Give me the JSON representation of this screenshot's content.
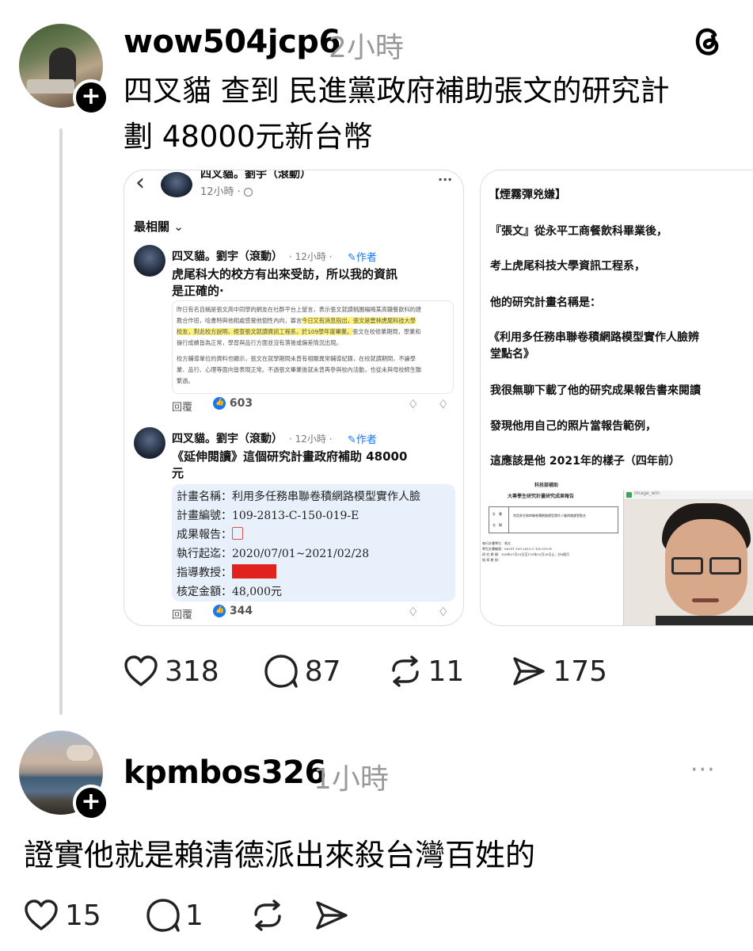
{
  "post": {
    "username": "wow504jcp6",
    "time": "2小時",
    "text_line1": "四叉貓 查到 民進黨政府補助張文的研究計",
    "text_line2": "劃 48000元新台幣",
    "plus": "+",
    "actions": {
      "likes": "318",
      "comments": "87",
      "reposts": "11",
      "shares": "175"
    }
  },
  "card1": {
    "back": "‹",
    "header_name": "四叉貓。劉宇（滾動）",
    "header_time": "12小時 · ",
    "more": "···",
    "sort_label": "最相關",
    "sort_chevron": "⌄",
    "c1_name": "四叉貓。劉宇（滾動）",
    "c1_time": "· 12小時 ·",
    "c1_author": "作者",
    "c1_text1": "虎尾科大的校方有出來受訪，所以我的資訊",
    "c1_text2": "是正確的·",
    "quote_l1": "昨日有名自稱是張文高中同學的網友在社群平台上留言，表示張文就讀桃園楊梅某高職餐飲科的建",
    "quote_l2": "教合作班，唸書時與他相處感覺他個性內向，寡言",
    "quote_l2b": "今日又有消息指出，張文是雲林虎尾科技大學",
    "quote_l3a": "校友，對此校方說明，經查張文就讀資訊工程系，於109學年度畢業。",
    "quote_l3b": "張文在校修業期間，學業和",
    "quote_l4": "操行成績皆為正常，學習與品行方面並沒有落後或偏差情況出現。",
    "quote_l5": "校方輔導單位的資料也顯示，張文在就學期間未曾有相關異常輔導紀錄，在校就讀期間，不論學",
    "quote_l6": "業、品行、心理等面向皆表現正常。不過張文畢業後就未曾再參與校內活動，也從未與母校師生聯",
    "quote_l7": "繫過。",
    "c1_reply": "回覆",
    "c1_likes": "603",
    "c2_name": "四叉貓。劉宇（滾動）",
    "c2_time": "· 12小時 ·",
    "c2_author": "作者",
    "c2_text1": "《延伸閱讀》這個研究計畫政府補助 48000",
    "c2_text2": "元",
    "plan": {
      "name_label": "計畫名稱：",
      "name_value": "利用多任務串聯卷積網路模型實作人臉",
      "id_label": "計畫編號：",
      "id_value": "109-2813-C-150-019-E",
      "report_label": "成果報告：",
      "period_label": "執行起迄：",
      "period_value": "2020/07/01~2021/02/28",
      "advisor_label": "指導教授：",
      "amount_label": "核定金額：",
      "amount_value": "48,000元"
    },
    "c2_reply": "回覆",
    "c2_likes": "344"
  },
  "card2": {
    "title": "【煙霧彈兇嫌】",
    "p1": "『張文』從永平工商餐飲科畢業後，",
    "p2": "考上虎尾科技大學資訊工程系，",
    "p3": "他的研究計畫名稱是：",
    "p4a": "《利用多任務串聯卷積網路模型實作人臉辨",
    "p4b": "堂點名》",
    "p5": "我很無聊下載了他的研究成果報告書來閱讀",
    "p6": "發現他用自己的照片當報告範例，",
    "p7": "這應該是他 2021年的樣子（四年前）",
    "doc_h1": "科技部補助",
    "doc_h2": "大專學生研究計畫研究成果報告",
    "doc_c1": "計　畫",
    "doc_c2": "名　稱",
    "doc_c3": "利用多任務串聯卷積網路模型實作人臉辨識課堂點名",
    "doc_r1": "執行計畫學生：張文",
    "doc_r2": "學生計畫編號：MOST 109-2813-C-150-019-E",
    "doc_r3": "研 究 期 間：109年07月01日至110年02月28日止，計8個月",
    "doc_r4": "指 導 教 授：",
    "photo_label": "image_win"
  },
  "reply": {
    "username": "kpmbos326",
    "time": "1小時",
    "more": "···",
    "plus": "+",
    "text": "證實他就是賴清德派出來殺台灣百姓的",
    "actions": {
      "likes": "15",
      "comments": "1"
    }
  },
  "colors": {
    "highlight": "#fff27a",
    "plan_bg": "#e7f0fb",
    "redact": "#e0231f",
    "fb_blue": "#1877f2"
  },
  "icons": [
    "threads-logo-icon",
    "heart-icon",
    "comment-icon",
    "repost-icon",
    "share-icon",
    "more-icon",
    "plus-icon",
    "back-chevron-icon",
    "globe-icon",
    "pen-icon",
    "thumbs-up-icon",
    "thumbs-down-icon",
    "pdf-icon"
  ]
}
